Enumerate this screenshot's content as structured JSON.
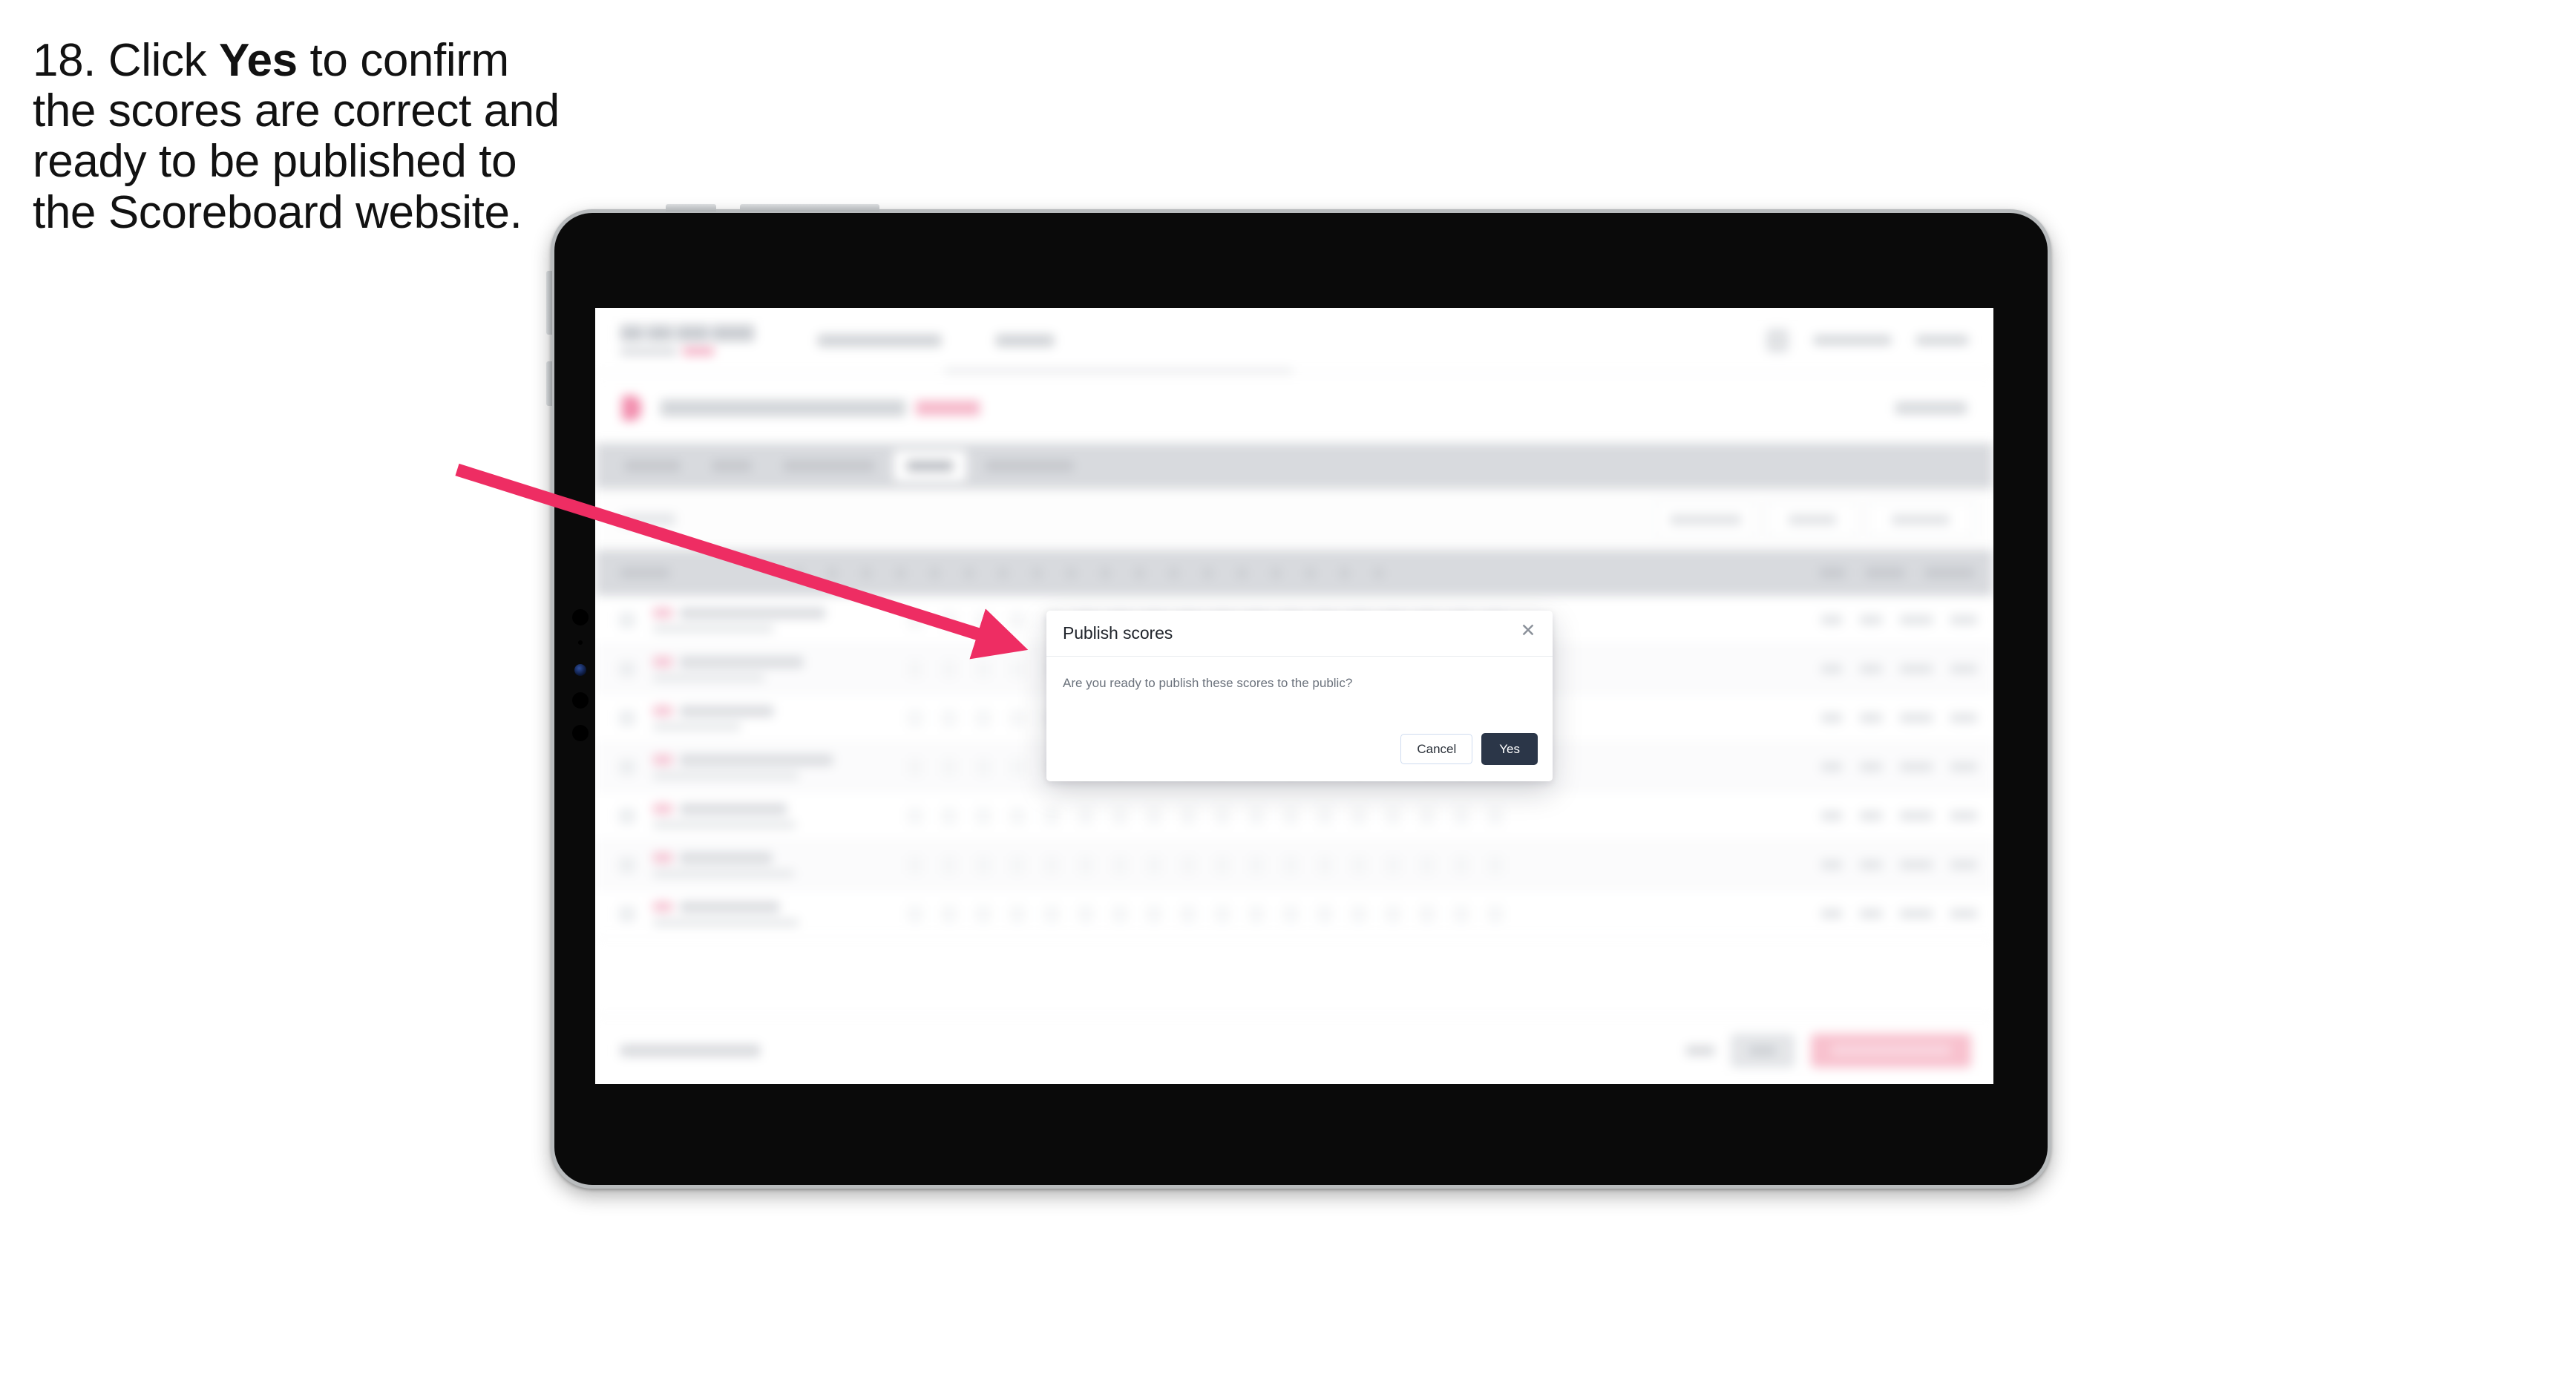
{
  "instruction": {
    "step_number": "18.",
    "text_before": "Click",
    "emphasis": "Yes",
    "text_after": "to confirm the scores are correct and ready to be published to the Scoreboard website.",
    "full_text": "18. Click Yes to confirm the scores are correct and ready to be published to the Scoreboard website."
  },
  "annotation": {
    "arrow_color": "#ee2d63",
    "points_to": "yes-button"
  },
  "device": {
    "type": "tablet",
    "orientation": "landscape",
    "bezel_color": "#0a0a0a",
    "frame_color": "#b9bcbe"
  },
  "dialog": {
    "title": "Publish scores",
    "close_icon": "close-icon",
    "message": "Are you ready to publish these scores to the public?",
    "cancel_label": "Cancel",
    "confirm_label": "Yes",
    "confirm_color": "#2b3648",
    "cancel_border_color": "#cfdcf0"
  },
  "background_app": {
    "blurred": true,
    "logo_text": "SCOREBOARD",
    "tab_count": 5,
    "active_tab_index": 3,
    "row_count": 7,
    "score_column_count": 18,
    "accent_color": "#ee2d63",
    "footer_primary_color": "#f8bfcd"
  }
}
